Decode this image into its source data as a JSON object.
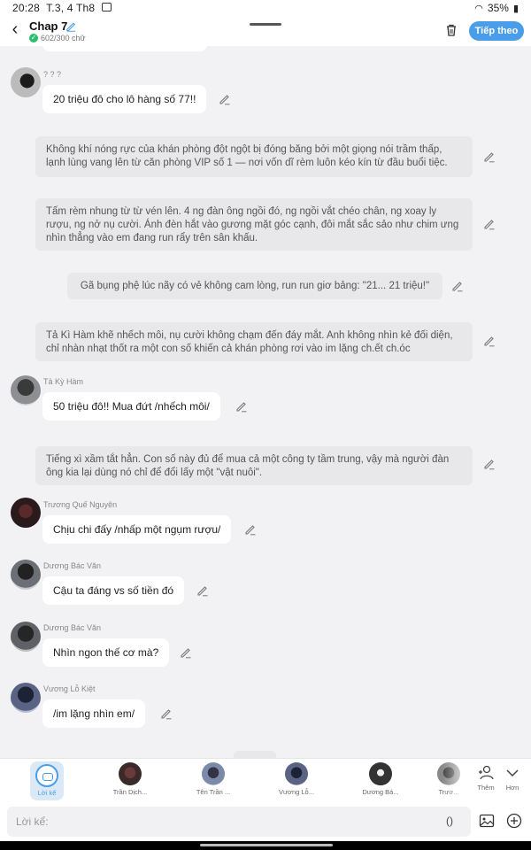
{
  "status_bar": {
    "time": "20:28",
    "date": "T.3, 4 Th8",
    "battery": "35%",
    "icons": [
      "gallery-icon",
      "wifi-icon",
      "battery-icon"
    ]
  },
  "header": {
    "title": "Chap 7",
    "word_count": "602/300 chữ",
    "next_label": "Tiếp theo",
    "accent": "#4a9de8"
  },
  "messages": [
    {
      "speaker": "? ? ?",
      "text": "20 triệu đô cho lô hàng số 77!!"
    },
    {
      "text": "Không khí nóng rực của khán phòng đột ngột bị đóng băng bởi một giọng nói trầm thấp, lạnh lùng vang lên từ căn phòng VIP số 1 — nơi vốn dĩ rèm luôn kéo kín từ đầu buổi tiệc."
    },
    {
      "text": "Tấm rèm nhung từ từ vén lên. 4 ng đàn ông ngồi đó, ng ngồi vắt chéo chân, ng xoay ly rượu, ng nở nụ cười. Ánh đèn hắt vào gương mặt góc cạnh, đôi mắt sắc sảo như chim ưng nhìn thẳng vào em đang run rẩy trên sân khấu."
    },
    {
      "text": "Gã bụng phệ lúc nãy có vẻ không cam lòng, run run giơ bảng: \"21... 21 triệu!\""
    },
    {
      "text": "Tả Kì Hàm khẽ nhếch môi, nụ cười không chạm đến đáy mắt. Anh không nhìn kẻ đối diện, chỉ nhàn nhạt thốt ra một con số khiến cả khán phòng rơi vào im lặng ch.ết ch.óc"
    },
    {
      "speaker": "Tả Kỳ Hàm",
      "text": "50 triệu đô!! Mua đứt /nhếch môi/"
    },
    {
      "text": "Tiếng xì xầm tắt hẳn. Con số này đủ để mua cả một công ty tầm trung, vậy mà người đàn ông kia lại dùng nó chỉ để đổi lấy một \"vật nuôi\"."
    },
    {
      "speaker": "Trương Quế Nguyên",
      "text": "Chịu chi đấy /nhấp một ngụm rượu/"
    },
    {
      "speaker": "Dương Bác Văn",
      "text": "Cậu ta đáng vs số tiền đó"
    },
    {
      "speaker": "Dương Bác Văn",
      "text": "Nhìn ngon thế cơ mà?"
    },
    {
      "speaker": "Vương Lỗ Kiệt",
      "text": "/im lặng nhìn em/"
    }
  ],
  "character_bar": {
    "narrator_label": "Lời kể",
    "characters": [
      "Trần Dịch...",
      "Tên Trần ...",
      "Vương Lỗ...",
      "Dương Bá...",
      "Trươ..."
    ],
    "add_label": "Thêm",
    "more_label": "Hơn"
  },
  "input": {
    "placeholder": "Lời kể:",
    "paren_label": "()"
  }
}
